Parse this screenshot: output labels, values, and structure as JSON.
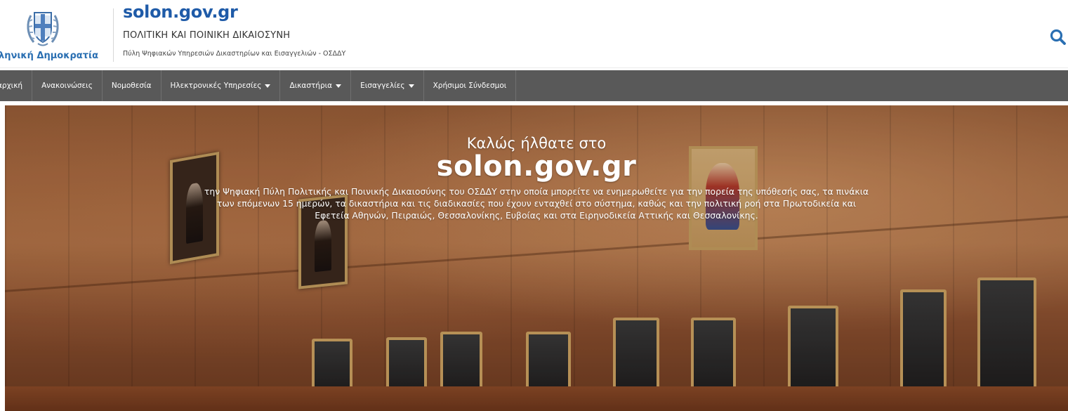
{
  "header": {
    "logo_text": "ληνική Δημοκρατία",
    "site_title": "solon.gov.gr",
    "subtitle": "ΠΟΛΙΤΙΚΗ ΚΑΙ ΠΟΙΝΙΚΗ ΔΙΚΑΙΟΣΥΝΗ",
    "subtitle2": "Πύλη Ψηφιακών Υπηρεσιών Δικαστηρίων και Εισαγγελιών - ΟΣΔΔΥ",
    "search_icon": "search-icon"
  },
  "nav": {
    "items": [
      {
        "label": "αρχική",
        "dropdown": false
      },
      {
        "label": "Ανακοινώσεις",
        "dropdown": false
      },
      {
        "label": "Νομοθεσία",
        "dropdown": false
      },
      {
        "label": "Ηλεκτρονικές Υπηρεσίες",
        "dropdown": true
      },
      {
        "label": "Δικαστήρια",
        "dropdown": true
      },
      {
        "label": "Εισαγγελίες",
        "dropdown": true
      },
      {
        "label": "Χρήσιμοι Σύνδεσμοι",
        "dropdown": false
      }
    ]
  },
  "hero": {
    "welcome": "Καλώς ήλθατε στο",
    "title": "solon.gov.gr",
    "description_lines": [
      "την Ψηφιακή Πύλη Πολιτικής και Ποινικής Δικαιοσύνης του ΟΣΔΔΥ στην οποία μπορείτε να ενημερωθείτε για την πορεία της υπόθεσής σας, τα πινάκια",
      "των επόμενων 15 ημερών, τα δικαστήρια και τις διαδικασίες που έχουν ενταχθεί στο σύστημα, καθώς και την πολιτική ροή στα Πρωτοδικεία και",
      "Εφετεία Αθηνών, Πειραιώς, Θεσσαλονίκης, Ευβοίας και στα Ειρηνοδικεία Αττικής και Θεσσαλονίκης."
    ]
  },
  "colors": {
    "brand_blue": "#1f5ba8",
    "nav_bg": "#595959",
    "nav_text": "#ffffff"
  }
}
